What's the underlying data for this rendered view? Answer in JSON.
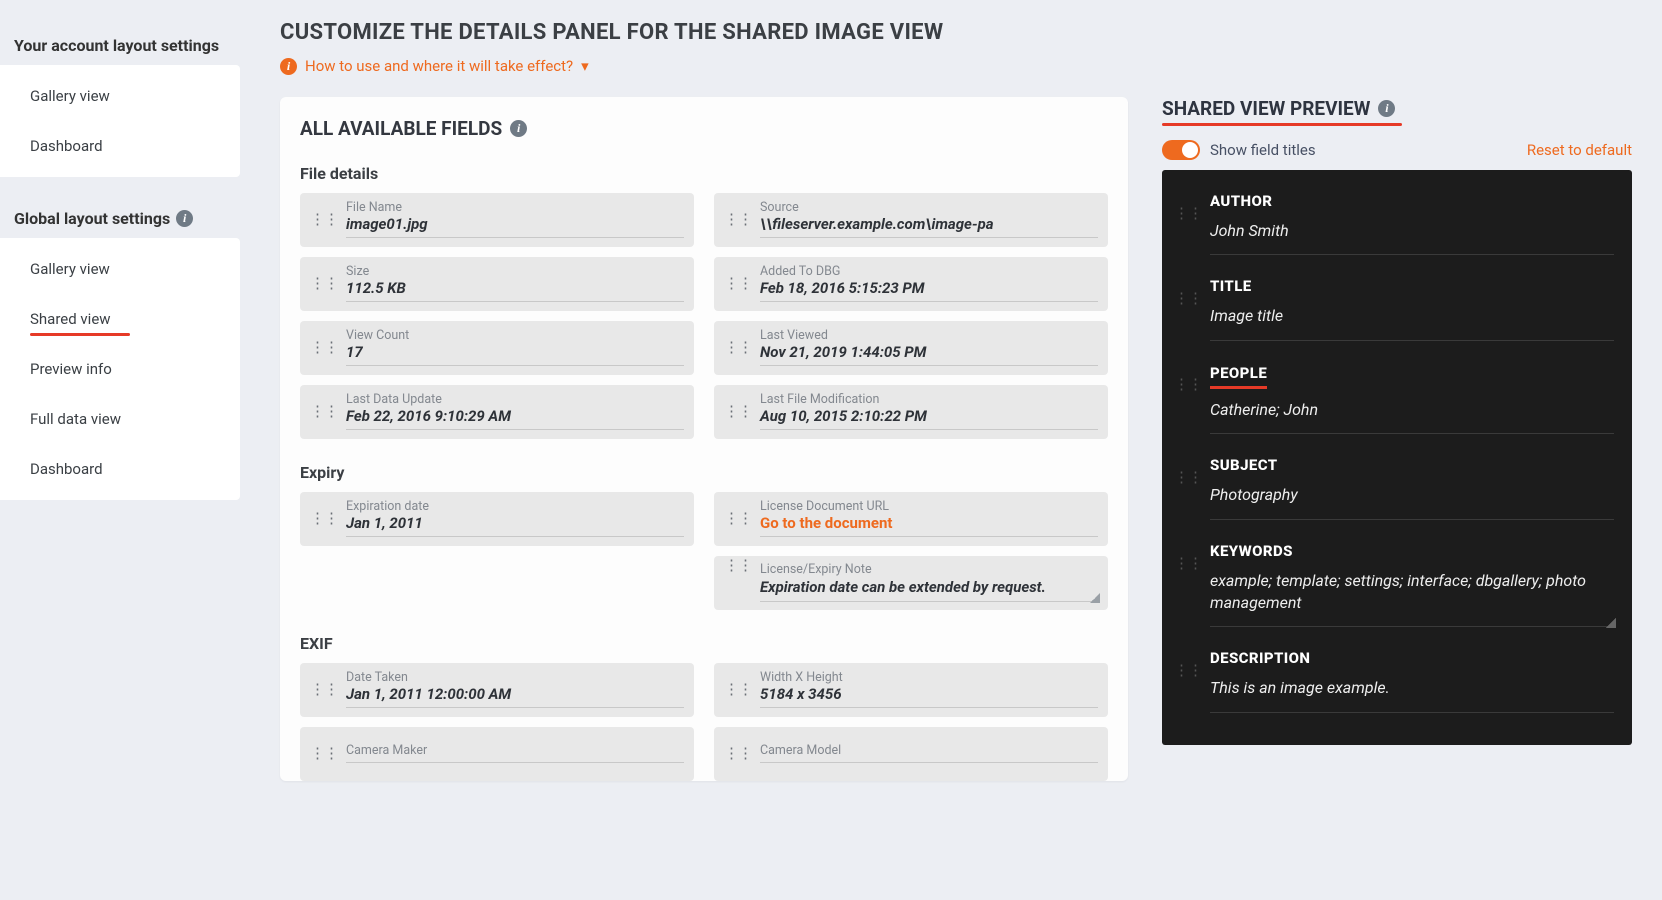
{
  "sidebar": {
    "account_heading": "Your account layout settings",
    "account_items": [
      "Gallery view",
      "Dashboard"
    ],
    "global_heading": "Global layout settings",
    "global_items": [
      "Gallery view",
      "Shared view",
      "Preview info",
      "Full data view",
      "Dashboard"
    ],
    "active_global_index": 1
  },
  "page": {
    "title": "CUSTOMIZE THE DETAILS PANEL FOR THE SHARED IMAGE VIEW",
    "help": "How to use and where it will take effect?"
  },
  "available": {
    "title": "ALL AVAILABLE FIELDS",
    "sections": {
      "file_details": {
        "heading": "File details",
        "fields": [
          {
            "label": "File Name",
            "value": "image01.jpg",
            "col": "left"
          },
          {
            "label": "Source",
            "value": "\\\\fileserver.example.com\\image-pa",
            "col": "right"
          },
          {
            "label": "Size",
            "value": "112.5 KB",
            "col": "left"
          },
          {
            "label": "Added To DBG",
            "value": "Feb 18, 2016 5:15:23 PM",
            "col": "right"
          },
          {
            "label": "View Count",
            "value": "17",
            "col": "left"
          },
          {
            "label": "Last Viewed",
            "value": "Nov 21, 2019 1:44:05 PM",
            "col": "right"
          },
          {
            "label": "Last Data Update",
            "value": "Feb 22, 2016 9:10:29 AM",
            "col": "left"
          },
          {
            "label": "Last File Modification",
            "value": "Aug 10, 2015 2:10:22 PM",
            "col": "right"
          }
        ]
      },
      "expiry": {
        "heading": "Expiry",
        "fields": [
          {
            "label": "Expiration date",
            "value": "Jan 1, 2011",
            "col": "left"
          },
          {
            "label": "License Document URL",
            "value": "Go to the document",
            "col": "right",
            "link": true
          },
          {
            "label": "License/Expiry Note",
            "value": "Expiration date can be extended by request.",
            "col": "right",
            "note": true
          }
        ]
      },
      "exif": {
        "heading": "EXIF",
        "fields": [
          {
            "label": "Date Taken",
            "value": "Jan 1, 2011 12:00:00 AM",
            "col": "left"
          },
          {
            "label": "Width X Height",
            "value": "5184 x 3456",
            "col": "right"
          },
          {
            "label": "Camera Maker",
            "value": "",
            "col": "left"
          },
          {
            "label": "Camera Model",
            "value": "",
            "col": "right"
          }
        ]
      }
    }
  },
  "preview": {
    "title": "SHARED VIEW PREVIEW",
    "toggle_label": "Show field titles",
    "reset": "Reset to default",
    "items": [
      {
        "label": "AUTHOR",
        "value": "John Smith"
      },
      {
        "label": "TITLE",
        "value": "Image title"
      },
      {
        "label": "PEOPLE",
        "value": "Catherine; John",
        "highlight": true
      },
      {
        "label": "SUBJECT",
        "value": "Photography"
      },
      {
        "label": "KEYWORDS",
        "value": "example; template; settings; interface; dbgallery; photo management",
        "resizable": true
      },
      {
        "label": "DESCRIPTION",
        "value": "This is an image example."
      }
    ]
  }
}
